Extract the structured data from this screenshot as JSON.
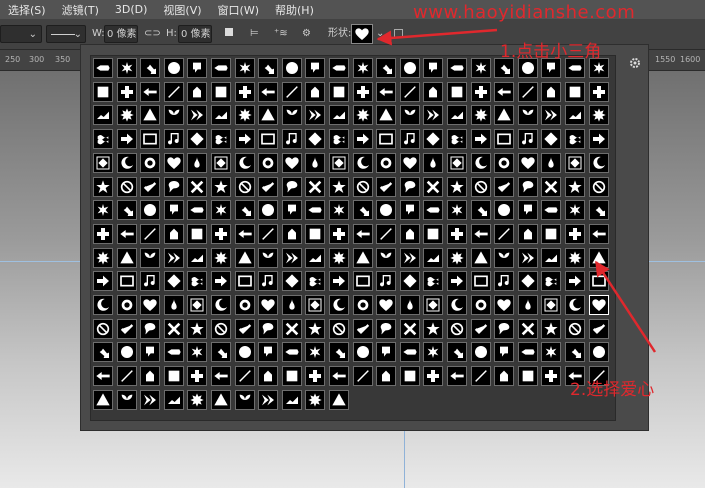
{
  "menu": [
    "选择(S)",
    "滤镜(T)",
    "3D(D)",
    "视图(V)",
    "窗口(W)",
    "帮助(H)"
  ],
  "options": {
    "w_label": "W:",
    "w_value": "0 像素",
    "h_label": "H:",
    "h_value": "0 像素",
    "shape_label": "形状:"
  },
  "ruler": {
    "left_ticks": [
      "250",
      "300",
      "350"
    ],
    "right_ticks": [
      "1550",
      "1600"
    ]
  },
  "watermark": "www.haoyidianshe.com",
  "annotations": {
    "step1": "1.点击小三角",
    "step2": "2.选择爱心"
  },
  "shape_picker": {
    "columns": 22,
    "rows": 15,
    "last_row_count": 11,
    "selected_shape": "heart-shape",
    "selected_index": 241
  },
  "colors": {
    "annotation": "#e0282d",
    "panel_bg": "#4a4a4a",
    "cell_bg": "#000000",
    "shape_fill": "#ffffff"
  }
}
